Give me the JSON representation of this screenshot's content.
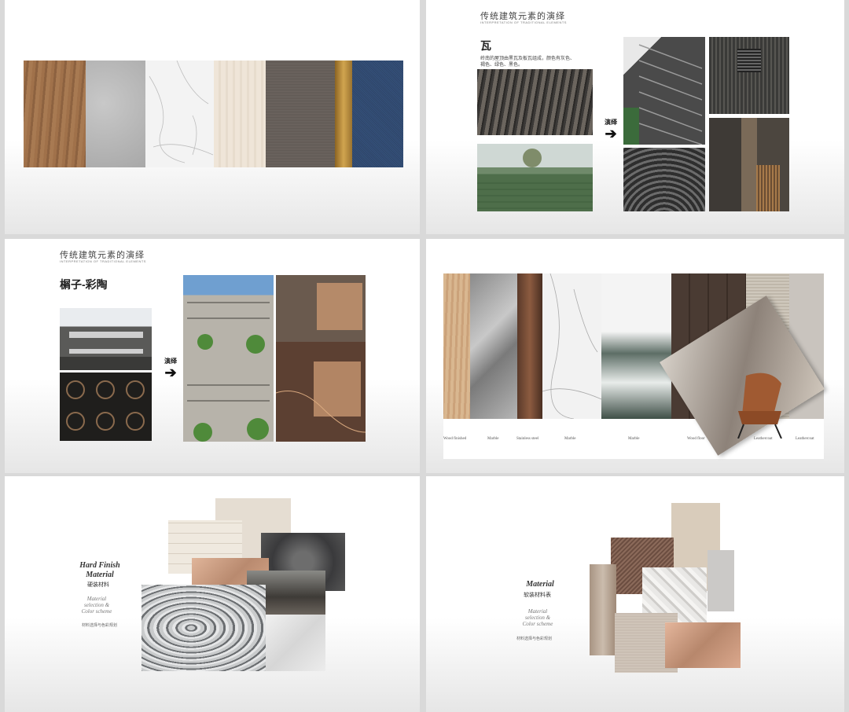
{
  "slide2": {
    "title_cn": "传统建筑元素的演绎",
    "title_en": "INTERPRETATION OF TRADITIONAL ELEMENTS",
    "heading": "瓦",
    "desc_line1": "岭南的屋顶由黑瓦及板瓦组成，颜色有灰色、",
    "desc_line2": "褐色、绿色、黑色。",
    "arrow_label": "演绎"
  },
  "slide3": {
    "title_cn": "传统建筑元素的演绎",
    "title_en": "INTERPRETATION OF TRADITIONAL ELEMENTS",
    "heading": "榍子-彩陶",
    "arrow_label": "演绎"
  },
  "slide4": {
    "labels": [
      "Wood finished",
      "Marble",
      "Stainless steel",
      "Marble",
      "Marble",
      "Wood floor",
      "Leathercoat",
      "Leathercoat"
    ]
  },
  "slide5": {
    "title_line1": "Hard Finish",
    "title_line2": "Material",
    "title_cn": "硬装材料",
    "sub_line1": "Material",
    "sub_line2": "selection  &",
    "sub_line3": "Color scheme",
    "footer_cn": "材料选择与色彩规划"
  },
  "slide6": {
    "title": "Material",
    "title_cn": "软装材料表",
    "sub_line1": "Material",
    "sub_line2": "selection  &",
    "sub_line3": "Color scheme",
    "footer_cn": "材料选择与色彩规划"
  },
  "colors": {
    "wood": "#9a6b45",
    "gray_stone": "#b9b9b9",
    "marble": "#f2f2f2",
    "beige": "#ede3d7",
    "fabric_gray": "#6d6560",
    "brass": "#b68a3c",
    "navy": "#2f4669",
    "copper": "#b98a6f",
    "highlight_red": "#c8302c"
  }
}
